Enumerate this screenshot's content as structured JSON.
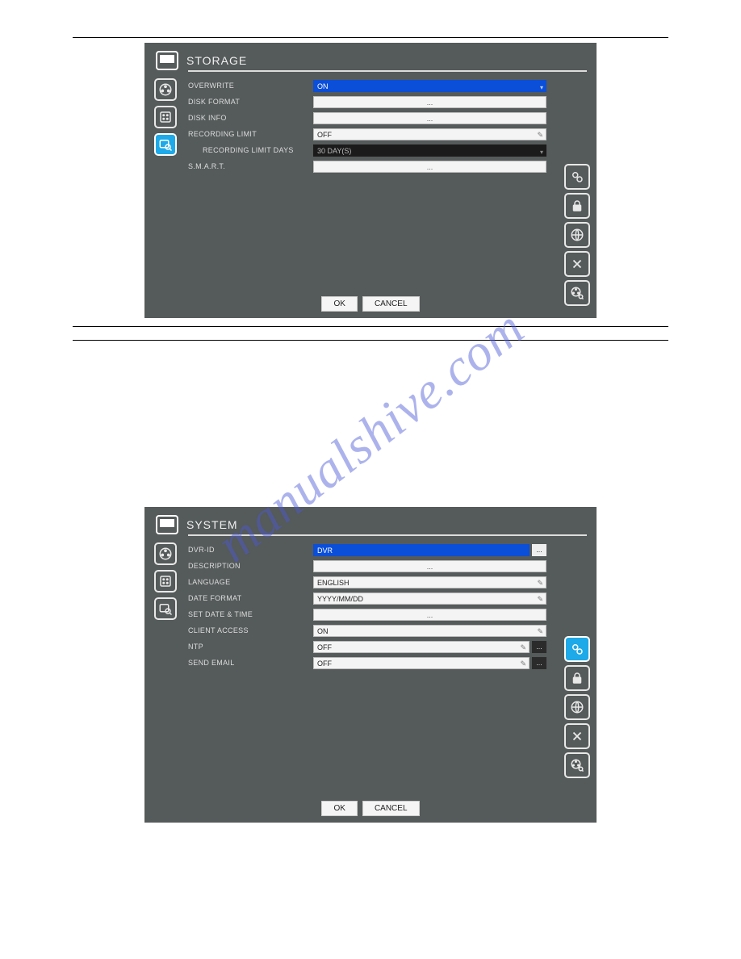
{
  "watermark": "manualshive.com",
  "panel1": {
    "title": "STORAGE",
    "rows": {
      "overwrite_label": "OVERWRITE",
      "overwrite_value": "ON",
      "diskformat_label": "DISK FORMAT",
      "diskformat_value": "...",
      "diskinfo_label": "DISK INFO",
      "diskinfo_value": "...",
      "reclimit_label": "RECORDING LIMIT",
      "reclimit_value": "OFF",
      "reclimitdays_label": "RECORDING LIMIT DAYS",
      "reclimitdays_value": "30 DAY(S)",
      "smart_label": "S.M.A.R.T.",
      "smart_value": "..."
    },
    "buttons": {
      "ok": "OK",
      "cancel": "CANCEL"
    },
    "nav_icons": [
      "monitor-icon",
      "reel-icon",
      "keypad-icon",
      "disk-search-icon"
    ],
    "side_icons": [
      "gears-icon",
      "lock-icon",
      "globe-icon",
      "tools-icon",
      "reel-search-icon"
    ]
  },
  "panel2": {
    "title": "SYSTEM",
    "rows": {
      "dvrid_label": "DVR-ID",
      "dvrid_value": "DVR",
      "dvrid_extra": "...",
      "desc_label": "DESCRIPTION",
      "desc_value": "...",
      "lang_label": "LANGUAGE",
      "lang_value": "ENGLISH",
      "datefmt_label": "DATE FORMAT",
      "datefmt_value": "YYYY/MM/DD",
      "setdate_label": "SET DATE & TIME",
      "setdate_value": "...",
      "client_label": "CLIENT ACCESS",
      "client_value": "ON",
      "ntp_label": "NTP",
      "ntp_value": "OFF",
      "ntp_extra": "...",
      "email_label": "SEND EMAIL",
      "email_value": "OFF",
      "email_extra": "..."
    },
    "buttons": {
      "ok": "OK",
      "cancel": "CANCEL"
    },
    "nav_icons": [
      "monitor-icon",
      "reel-icon",
      "keypad-icon",
      "disk-search-icon"
    ],
    "side_icons": [
      "gears-icon",
      "lock-icon",
      "globe-icon",
      "tools-icon",
      "reel-search-icon"
    ]
  }
}
